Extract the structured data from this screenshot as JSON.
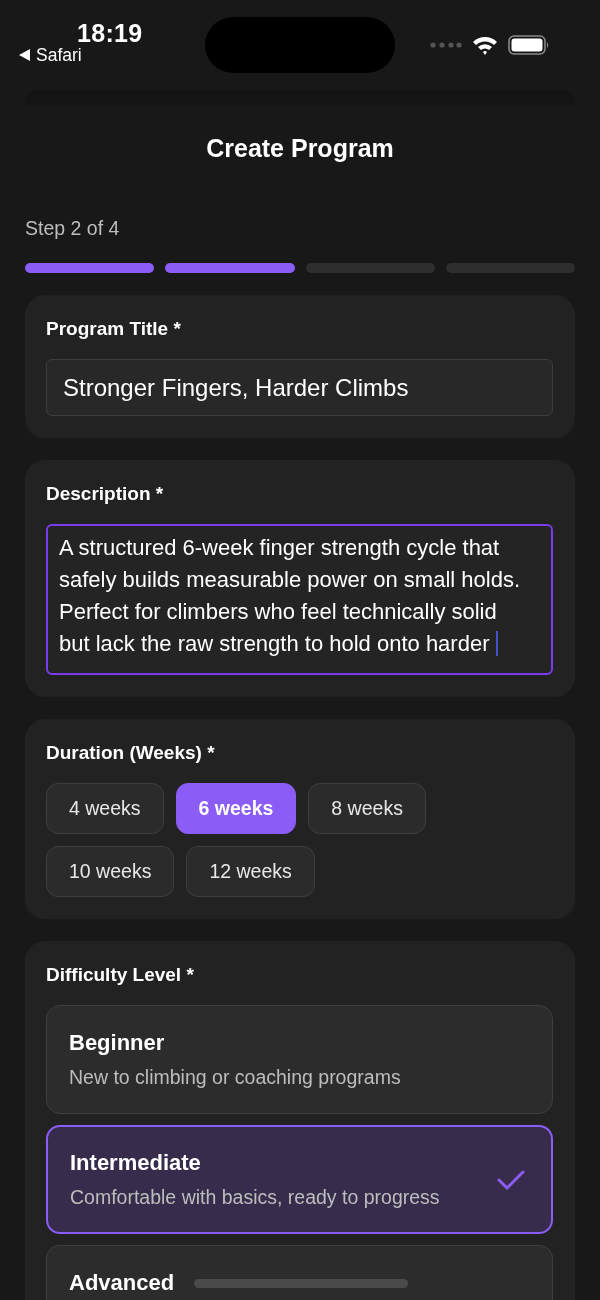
{
  "status_bar": {
    "time": "18:19",
    "back_label": "Safari"
  },
  "header": {
    "title": "Create Program"
  },
  "progress": {
    "label": "Step 2 of 4",
    "steps": [
      {
        "completed": true
      },
      {
        "completed": true
      },
      {
        "completed": false
      },
      {
        "completed": false
      }
    ]
  },
  "program_title": {
    "label": "Program Title *",
    "value": "Stronger Fingers, Harder Climbs"
  },
  "description": {
    "label": "Description *",
    "value": "A structured 6-week finger strength cycle that safely builds measurable power on small holds. Perfect for climbers who feel technically solid but lack the raw strength to hold onto harder",
    "focused": true
  },
  "duration": {
    "label": "Duration (Weeks) *",
    "options": [
      {
        "label": "4 weeks",
        "selected": false
      },
      {
        "label": "6 weeks",
        "selected": true
      },
      {
        "label": "8 weeks",
        "selected": false
      },
      {
        "label": "10 weeks",
        "selected": false
      },
      {
        "label": "12 weeks",
        "selected": false
      }
    ]
  },
  "difficulty": {
    "label": "Difficulty Level *",
    "options": [
      {
        "title": "Beginner",
        "description": "New to climbing or coaching programs",
        "selected": false
      },
      {
        "title": "Intermediate",
        "description": "Comfortable with basics, ready to progress",
        "selected": true
      },
      {
        "title": "Advanced",
        "selected": false
      }
    ]
  }
}
